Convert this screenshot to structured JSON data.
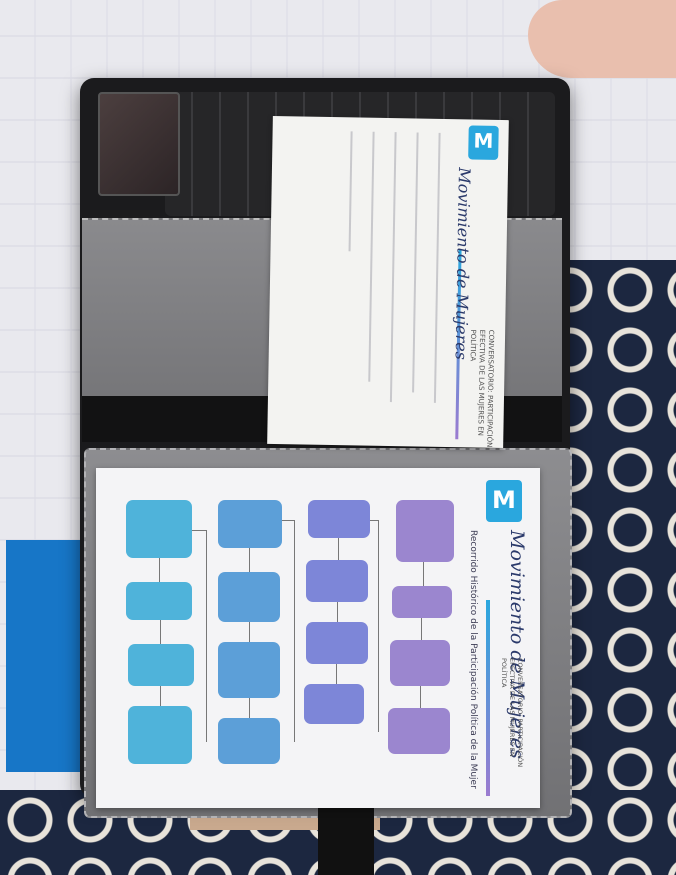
{
  "questionnaire": {
    "logo_letter": "M",
    "brand": "Movimiento de Mujeres",
    "event_title": "CONVERSATORIO: PARTICIPACIÓN EFECTIVA DE LAS MUJERES EN POLÍTICA"
  },
  "timeline": {
    "logo_letter": "M",
    "brand": "Movimiento de Mujeres",
    "subtitle": "Recorrido Histórico de la Participación Política de la Mujer",
    "event_title": "CONVERSATORIO: PARTICIPACIÓN EFECTIVA DE LAS MUJERES EN POLÍTICA"
  },
  "colors": {
    "brand_blue": "#2aa7de",
    "brand_navy": "#2b3a6b",
    "purple": "#9b86cf",
    "periwinkle": "#7d86d8",
    "blue": "#5c9fd8",
    "cyan": "#4fb3da"
  }
}
